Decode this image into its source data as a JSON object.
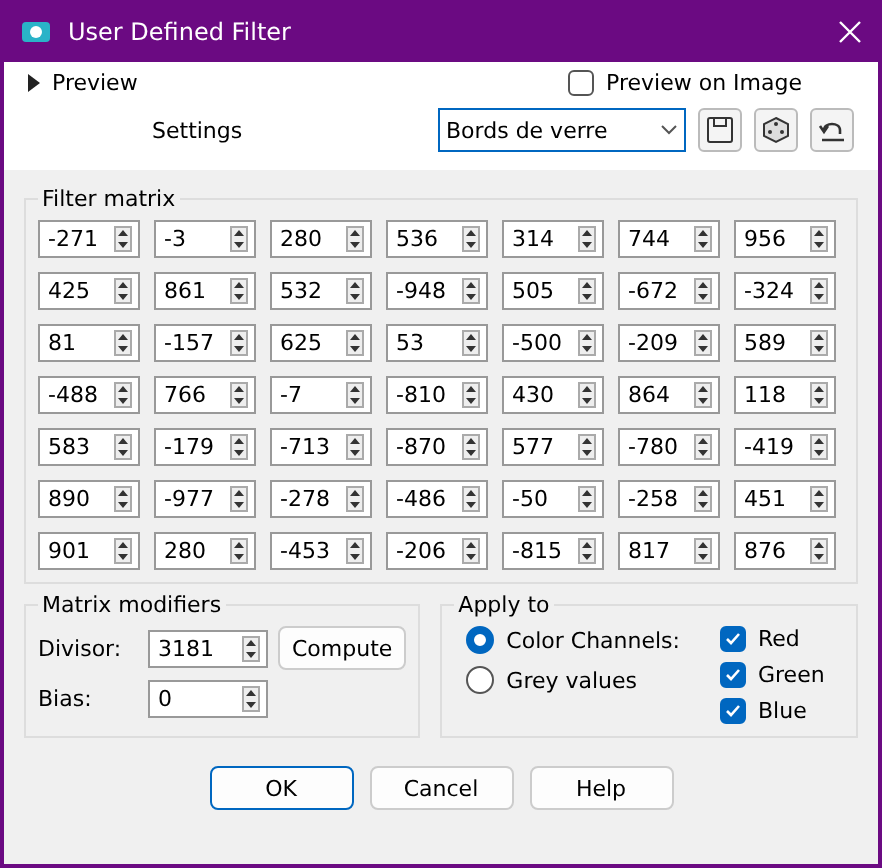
{
  "window": {
    "title": "User Defined Filter"
  },
  "preview": {
    "label": "Preview",
    "expanded": false
  },
  "preview_on_image": {
    "label": "Preview on Image",
    "checked": false
  },
  "settings": {
    "label": "Settings",
    "value": "Bords de verre"
  },
  "filter_matrix": {
    "title": "Filter matrix",
    "rows": [
      [
        "-271",
        "-3",
        "280",
        "536",
        "314",
        "744",
        "956"
      ],
      [
        "425",
        "861",
        "532",
        "-948",
        "505",
        "-672",
        "-324"
      ],
      [
        "81",
        "-157",
        "625",
        "53",
        "-500",
        "-209",
        "589"
      ],
      [
        "-488",
        "766",
        "-7",
        "-810",
        "430",
        "864",
        "118"
      ],
      [
        "583",
        "-179",
        "-713",
        "-870",
        "577",
        "-780",
        "-419"
      ],
      [
        "890",
        "-977",
        "-278",
        "-486",
        "-50",
        "-258",
        "451"
      ],
      [
        "901",
        "280",
        "-453",
        "-206",
        "-815",
        "817",
        "876"
      ]
    ]
  },
  "matrix_modifiers": {
    "title": "Matrix modifiers",
    "divisor_label": "Divisor:",
    "divisor": "3181",
    "bias_label": "Bias:",
    "bias": "0",
    "compute": "Compute"
  },
  "apply_to": {
    "title": "Apply to",
    "options": [
      {
        "label": "Color Channels:",
        "selected": true
      },
      {
        "label": "Grey values",
        "selected": false
      }
    ],
    "channels": [
      {
        "label": "Red",
        "checked": true
      },
      {
        "label": "Green",
        "checked": true
      },
      {
        "label": "Blue",
        "checked": true
      }
    ]
  },
  "buttons": [
    "OK",
    "Cancel",
    "Help"
  ]
}
